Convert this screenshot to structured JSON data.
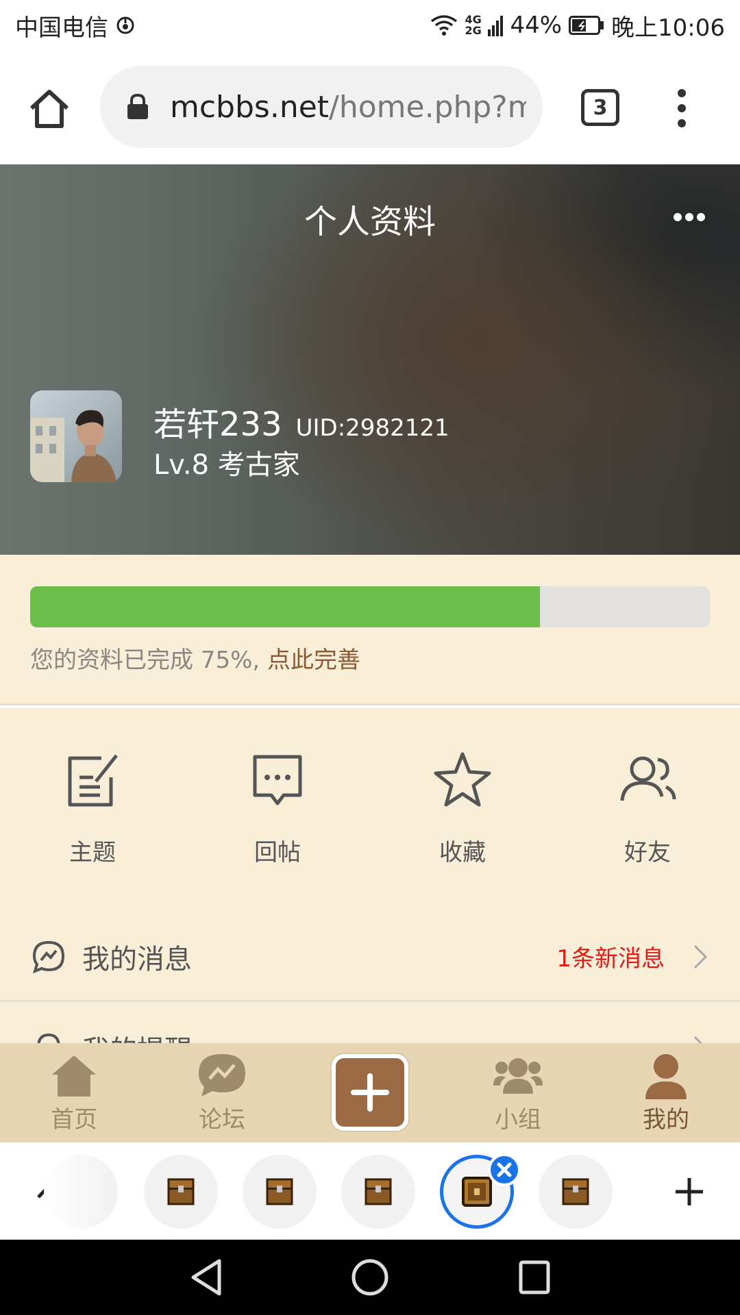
{
  "status_bar": {
    "carrier": "中国电信",
    "network": "4G 2G",
    "battery": "44%",
    "time": "晚上10:06"
  },
  "browser": {
    "url_host": "mcbbs.net",
    "url_path": "/home.php?m",
    "tab_count": "3"
  },
  "profile": {
    "title": "个人资料",
    "username": "若轩233",
    "uid": "UID:2982121",
    "level": "Lv.8 考古家"
  },
  "completion": {
    "percent": 75,
    "text": "您的资料已完成 75%, ",
    "link": "点此完善"
  },
  "shortcuts": [
    {
      "label": "主题",
      "icon": "edit-note-icon"
    },
    {
      "label": "回帖",
      "icon": "message-square-icon"
    },
    {
      "label": "收藏",
      "icon": "star-icon"
    },
    {
      "label": "好友",
      "icon": "users-icon"
    }
  ],
  "list": {
    "messages": {
      "label": "我的消息",
      "badge": "1条新消息",
      "icon": "chat-icon"
    },
    "reminders": {
      "label": "我的提醒",
      "icon": "bell-icon"
    }
  },
  "bottom_nav": [
    {
      "label": "首页",
      "icon": "home-icon"
    },
    {
      "label": "论坛",
      "icon": "forum-icon"
    },
    {
      "label": "小组",
      "icon": "group-icon"
    },
    {
      "label": "我的",
      "icon": "user-icon",
      "active": true
    }
  ],
  "colors": {
    "accent_brown": "#9a6a44",
    "progress_green": "#6cbd4a",
    "badge_red": "#e31b14",
    "page_bg": "#f9efd9",
    "nav_bg": "#e7d6b3",
    "tab_blue": "#1a73e8"
  }
}
